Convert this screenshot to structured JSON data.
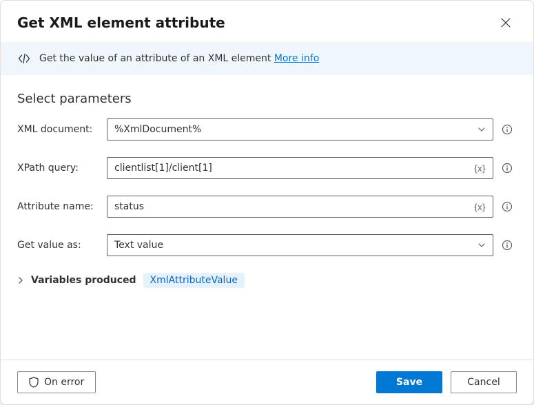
{
  "header": {
    "title": "Get XML element attribute"
  },
  "info": {
    "text": "Get the value of an attribute of an XML element",
    "link_label": "More info"
  },
  "section_heading": "Select parameters",
  "fields": {
    "xml_document": {
      "label": "XML document:",
      "value": "%XmlDocument%"
    },
    "xpath_query": {
      "label": "XPath query:",
      "value": "clientlist[1]/client[1]"
    },
    "attribute_name": {
      "label": "Attribute name:",
      "value": "status"
    },
    "get_value_as": {
      "label": "Get value as:",
      "value": "Text value"
    }
  },
  "variables": {
    "label": "Variables produced",
    "chip": "XmlAttributeValue"
  },
  "footer": {
    "on_error": "On error",
    "save": "Save",
    "cancel": "Cancel"
  }
}
